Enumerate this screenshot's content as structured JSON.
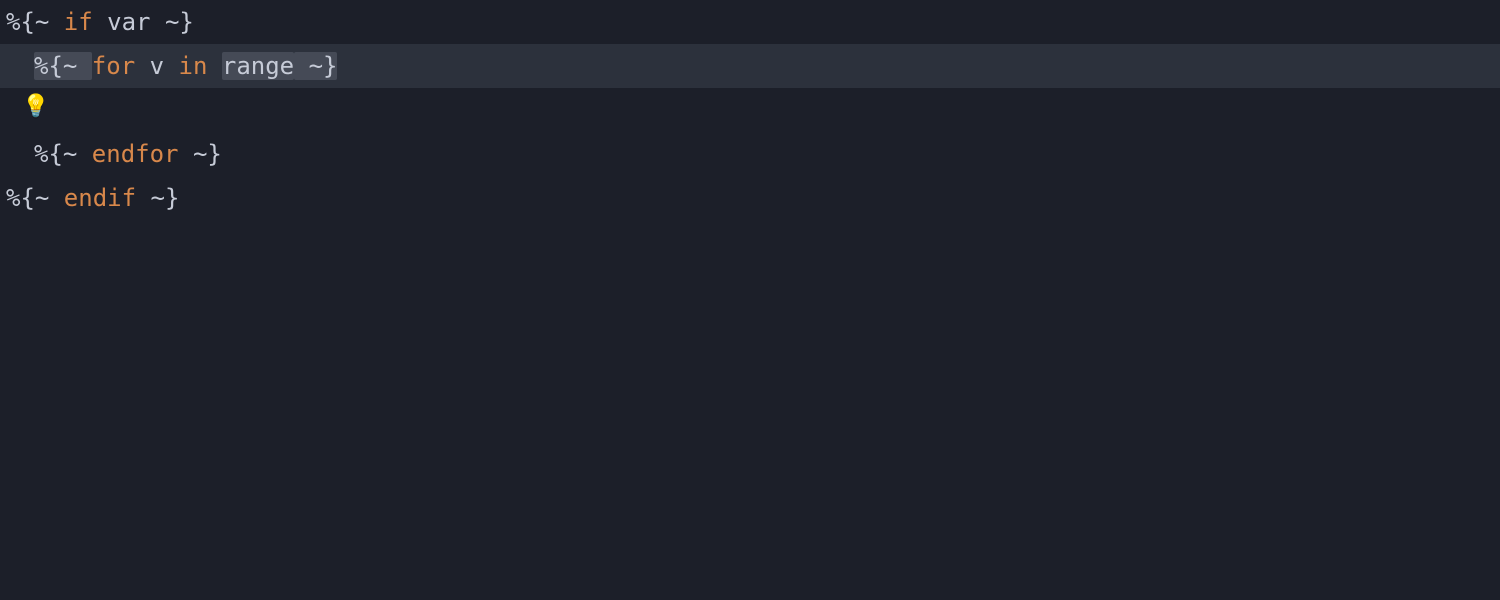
{
  "editor": {
    "lightbulb_icon": "💡",
    "lines": [
      {
        "indent": 0,
        "highlighted": false,
        "tokens": {
          "d_open": "%{~ ",
          "kw": "if",
          "sp1": " ",
          "id1": "var",
          "d_close": " ~}"
        }
      },
      {
        "indent": 1,
        "highlighted": true,
        "tokens": {
          "d_open": "%{~ ",
          "kw": "for",
          "sp1": " ",
          "id1": "v",
          "sp2": " ",
          "kw2": "in",
          "sp3": " ",
          "id2": "range",
          "d_close": " ~}"
        }
      },
      {
        "indent": 0,
        "highlighted": false,
        "tokens": {}
      },
      {
        "indent": 1,
        "highlighted": false,
        "tokens": {
          "d_open": "%{~ ",
          "kw": "endfor",
          "d_close": " ~}"
        }
      },
      {
        "indent": 0,
        "highlighted": false,
        "tokens": {
          "d_open": "%{~ ",
          "kw": "endif",
          "d_close": " ~}"
        }
      }
    ]
  }
}
